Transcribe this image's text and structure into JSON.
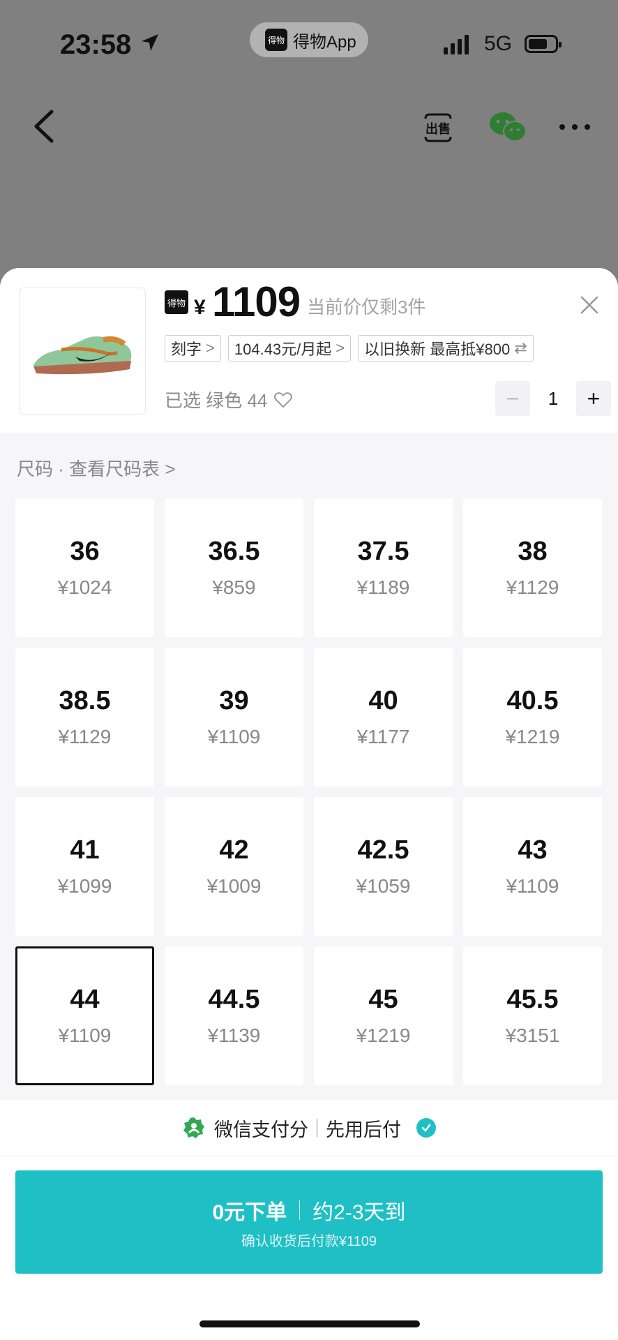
{
  "status_bar": {
    "time": "23:58",
    "app_name": "得物App",
    "network": "5G"
  },
  "nav": {
    "sell_label": "出售"
  },
  "product": {
    "badge_text": "得物",
    "currency": "¥",
    "price": "1109",
    "stock_note": "当前价仅剩3件",
    "chips": [
      {
        "label": "刻字",
        "suffix": ">"
      },
      {
        "label": "104.43元/月起",
        "suffix": ">"
      },
      {
        "label": "以旧换新 最高抵¥800",
        "suffix": "⇄"
      }
    ],
    "selected_text": "已选 绿色 44",
    "quantity": "1"
  },
  "size_section": {
    "title": "尺码 · 查看尺码表 >"
  },
  "sizes": [
    {
      "size": "36",
      "price": "¥1024"
    },
    {
      "size": "36.5",
      "price": "¥859"
    },
    {
      "size": "37.5",
      "price": "¥1189"
    },
    {
      "size": "38",
      "price": "¥1129"
    },
    {
      "size": "38.5",
      "price": "¥1129"
    },
    {
      "size": "39",
      "price": "¥1109"
    },
    {
      "size": "40",
      "price": "¥1177"
    },
    {
      "size": "40.5",
      "price": "¥1219"
    },
    {
      "size": "41",
      "price": "¥1099"
    },
    {
      "size": "42",
      "price": "¥1009"
    },
    {
      "size": "42.5",
      "price": "¥1059"
    },
    {
      "size": "43",
      "price": "¥1109"
    },
    {
      "size": "44",
      "price": "¥1109",
      "selected": true
    },
    {
      "size": "44.5",
      "price": "¥1139"
    },
    {
      "size": "45",
      "price": "¥1219"
    },
    {
      "size": "45.5",
      "price": "¥3151"
    }
  ],
  "payment": {
    "label1": "微信支付分",
    "label2": "先用后付"
  },
  "order_button": {
    "main": "0元下单",
    "eta": "约2-3天到",
    "sub": "确认收货后付款¥1109"
  },
  "colors": {
    "accent": "#1FC0C5",
    "overlay": "#808080",
    "sheet_bg": "#F6F6F9"
  }
}
